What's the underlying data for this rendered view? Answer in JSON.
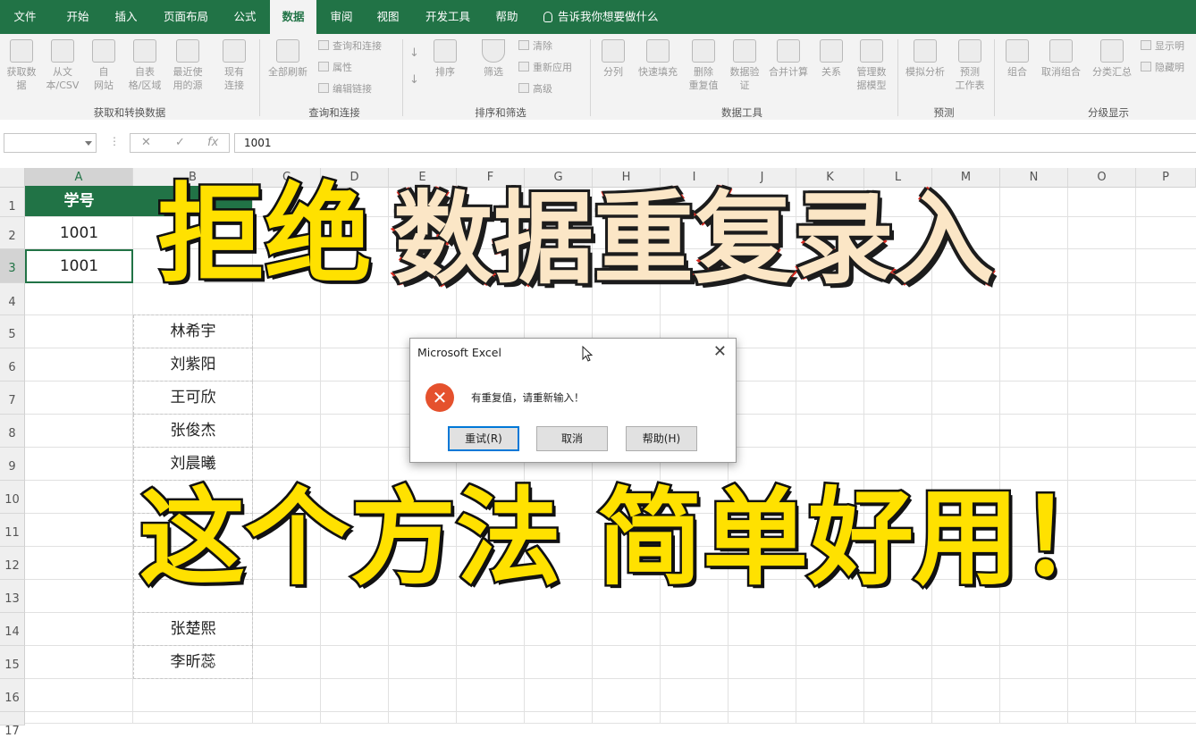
{
  "tabs": [
    "文件",
    "开始",
    "插入",
    "页面布局",
    "公式",
    "数据",
    "审阅",
    "视图",
    "开发工具",
    "帮助"
  ],
  "active_tab": "数据",
  "tell_me": "告诉我你想要做什么",
  "ribbon": {
    "get_transform": [
      "获取数\n据",
      "从文\n本/CSV",
      "自\n网站",
      "自表\n格/区域",
      "最近使\n用的源",
      "现有\n连接"
    ],
    "get_transform_label": "获取和转换数据",
    "refresh_all": "全部刷新",
    "queries_small": [
      "查询和连接",
      "属性",
      "编辑链接"
    ],
    "queries_label": "查询和连接",
    "sort_btn": "排序",
    "filter_btn": "筛选",
    "filter_small": [
      "清除",
      "重新应用",
      "高级"
    ],
    "sort_label": "排序和筛选",
    "data_tools": [
      "分列",
      "快速填充",
      "删除\n重复值",
      "数据验\n证",
      "合并计算",
      "关系",
      "管理数\n据模型"
    ],
    "data_tools_label": "数据工具",
    "forecast": [
      "模拟分析",
      "预测\n工作表"
    ],
    "forecast_label": "预测",
    "outline": [
      "组合",
      "取消组合",
      "分类汇总"
    ],
    "outline_small": [
      "显示明",
      "隐藏明"
    ],
    "outline_label": "分级显示"
  },
  "formula_bar": {
    "name_box": "",
    "cancel": "✕",
    "enter": "✓",
    "fx": "fx",
    "value": "1001"
  },
  "columns": [
    "A",
    "B",
    "C",
    "D",
    "E",
    "F",
    "G",
    "H",
    "I",
    "J",
    "K",
    "L",
    "M",
    "N",
    "O",
    "P"
  ],
  "rows": [
    "1",
    "2",
    "3",
    "4",
    "5",
    "6",
    "7",
    "8",
    "9",
    "10",
    "11",
    "12",
    "13",
    "14",
    "15",
    "16",
    "17"
  ],
  "cells": {
    "a1": "学号",
    "a2": "1001",
    "a3": "1001",
    "names": [
      "林希宇",
      "刘紫阳",
      "王可欣",
      "张俊杰",
      "刘晨曦",
      "张楚熙",
      "李昕蕊"
    ]
  },
  "overlay": {
    "line1_a": "拒绝",
    "line1_b": "数据重复录入",
    "line2_a": "这个方法",
    "line2_b": "简单好用！"
  },
  "dialog": {
    "title": "Microsoft Excel",
    "close": "✕",
    "error_icon": "✕",
    "message": "有重复值，请重新输入！",
    "buttons": [
      "重试(R)",
      "取消",
      "帮助(H)"
    ]
  }
}
